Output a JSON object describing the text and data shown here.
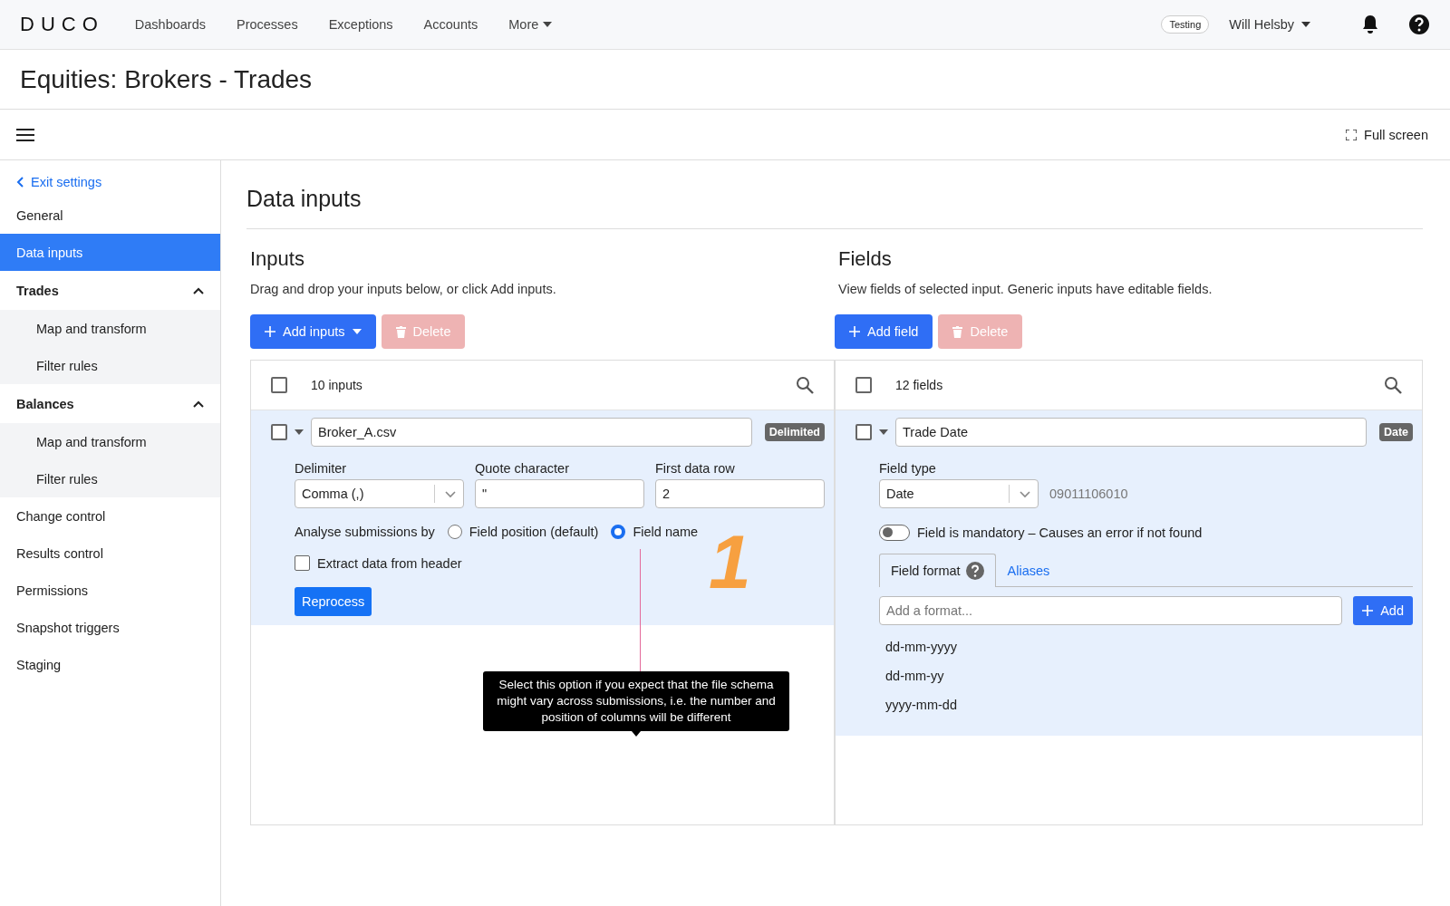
{
  "brand": {
    "logo": "DUCO"
  },
  "nav": [
    "Dashboards",
    "Processes",
    "Exceptions",
    "Accounts"
  ],
  "more_menu": "More",
  "environment_badge": "Testing",
  "user": "Will Helsby",
  "page_title": "Equities: Brokers - Trades",
  "fullscreen_button": "Full screen",
  "sidebar": {
    "back_link": "Exit settings",
    "items": [
      {
        "kind": "item",
        "label": "General",
        "selected": false
      },
      {
        "kind": "item",
        "label": "Data inputs",
        "selected": true
      },
      {
        "kind": "group",
        "label": "Trades",
        "expanded": true,
        "children": [
          {
            "label": "Map and transform",
            "selected": false
          },
          {
            "label": "Filter rules",
            "selected": false
          }
        ]
      },
      {
        "kind": "group",
        "label": "Balances",
        "expanded": true,
        "children": [
          {
            "label": "Map and transform",
            "selected": false
          },
          {
            "label": "Filter rules",
            "selected": false
          }
        ]
      },
      {
        "kind": "item",
        "label": "Change control",
        "selected": false
      },
      {
        "kind": "item",
        "label": "Results control",
        "selected": false
      },
      {
        "kind": "item",
        "label": "Permissions",
        "selected": false
      },
      {
        "kind": "item",
        "label": "Snapshot triggers",
        "selected": false
      },
      {
        "kind": "item",
        "label": "Staging",
        "selected": false
      }
    ]
  },
  "section_title": "Data inputs",
  "inputs": {
    "heading": "Inputs",
    "description": "Drag and drop your inputs below, or click Add inputs.",
    "add_button": "Add inputs",
    "delete_button": {
      "label": "Delete",
      "disabled": true
    },
    "count_label": "10 inputs",
    "select_all_checked": false,
    "row": {
      "checked": false,
      "expanded": true,
      "name": "Broker_A.csv",
      "badge": "Delimited",
      "delimiter_label": "Delimiter",
      "delimiter_value": "Comma (,)",
      "quote_label": "Quote character",
      "quote_value": "\"",
      "first_row_label": "First data row",
      "first_row_value": "2",
      "analyse_label": "Analyse submissions by",
      "options": [
        {
          "label": "Field position (default)",
          "selected": false
        },
        {
          "label": "Field name",
          "selected": true
        }
      ],
      "extract_checkbox": {
        "label": "Extract data from header",
        "checked": false
      },
      "reprocess_button": "Reprocess"
    },
    "tooltip": "Select this option if you expect that the file schema might vary across submissions, i.e. the number and position of columns will be different",
    "annotation": "1"
  },
  "fields": {
    "heading": "Fields",
    "description": "View fields of selected input. Generic inputs have editable fields.",
    "add_button": "Add field",
    "delete_button": {
      "label": "Delete",
      "disabled": true
    },
    "count_label": "12 fields",
    "select_all_checked": false,
    "row": {
      "checked": false,
      "expanded": true,
      "name": "Trade Date",
      "badge": "Date",
      "field_type_label": "Field type",
      "field_type_value": "Date",
      "sample_value": "09011106010",
      "mandatory": {
        "label": "Field is mandatory – Causes an error if not found",
        "on": false
      },
      "tabs": [
        {
          "label": "Field format",
          "selected": true
        },
        {
          "label": "Aliases",
          "selected": false
        }
      ],
      "format_placeholder": "Add a format...",
      "add_button": "Add",
      "formats": [
        "dd-mm-yyyy",
        "dd-mm-yy",
        "yyyy-mm-dd"
      ]
    }
  }
}
